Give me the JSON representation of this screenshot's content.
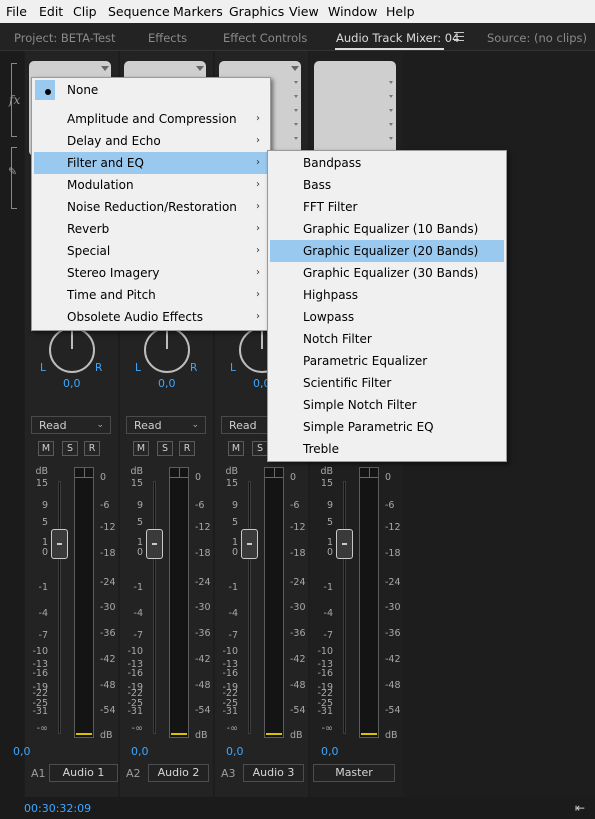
{
  "menubar": [
    "File",
    "Edit",
    "Clip",
    "Sequence",
    "Markers",
    "Graphics",
    "View",
    "Window",
    "Help"
  ],
  "tabs": {
    "project": "Project: BETA-Test",
    "effects": "Effects",
    "effect_controls": "Effect Controls",
    "audio_track_mixer": "Audio Track Mixer: 04",
    "source": "Source: (no clips)"
  },
  "gutter": {
    "fx": "fx"
  },
  "mixer": {
    "pan_l": "L",
    "pan_r": "R",
    "pan_value": "0,0",
    "automation_mode": "Read",
    "buttons": {
      "mute": "M",
      "solo": "S",
      "record": "R"
    },
    "db_scale_left": [
      "dB",
      "15",
      "9",
      "5",
      "1",
      "0",
      "-1",
      "-4",
      "-7",
      "-10",
      "-13",
      "-16",
      "-19",
      "-22",
      "-25",
      "-31",
      "-∞"
    ],
    "db_scale_right": [
      "0",
      "-6",
      "-12",
      "-18",
      "-24",
      "-30",
      "-36",
      "-42",
      "-48",
      "-54",
      "dB"
    ],
    "volume_value": "0,0",
    "tracks": [
      {
        "id": "A1",
        "name": "Audio 1"
      },
      {
        "id": "A2",
        "name": "Audio 2"
      },
      {
        "id": "A3",
        "name": "Audio 3"
      },
      {
        "id": "",
        "name": "Master"
      }
    ]
  },
  "status": {
    "timecode": "00:30:32:09"
  },
  "effect_menu": {
    "selected": "None",
    "categories": [
      "Amplitude and Compression",
      "Delay and Echo",
      "Filter and EQ",
      "Modulation",
      "Noise Reduction/Restoration",
      "Reverb",
      "Special",
      "Stereo Imagery",
      "Time and Pitch",
      "Obsolete Audio Effects"
    ],
    "highlighted_category": "Filter and EQ"
  },
  "filter_submenu": {
    "items": [
      "Bandpass",
      "Bass",
      "FFT Filter",
      "Graphic Equalizer (10 Bands)",
      "Graphic Equalizer (20 Bands)",
      "Graphic Equalizer (30 Bands)",
      "Highpass",
      "Lowpass",
      "Notch Filter",
      "Parametric Equalizer",
      "Scientific Filter",
      "Simple Notch Filter",
      "Simple Parametric EQ",
      "Treble"
    ],
    "highlighted_item": "Graphic Equalizer (20 Bands)"
  },
  "colors": {
    "accent_blue": "#3ea6ff",
    "menu_highlight": "#99c9ef",
    "peak_yellow": "#d9c300"
  },
  "icons": {
    "panel_menu": "hamburger-icon",
    "submenu_arrow": "chevron-right-icon",
    "fit": "fit-to-panel-icon"
  }
}
